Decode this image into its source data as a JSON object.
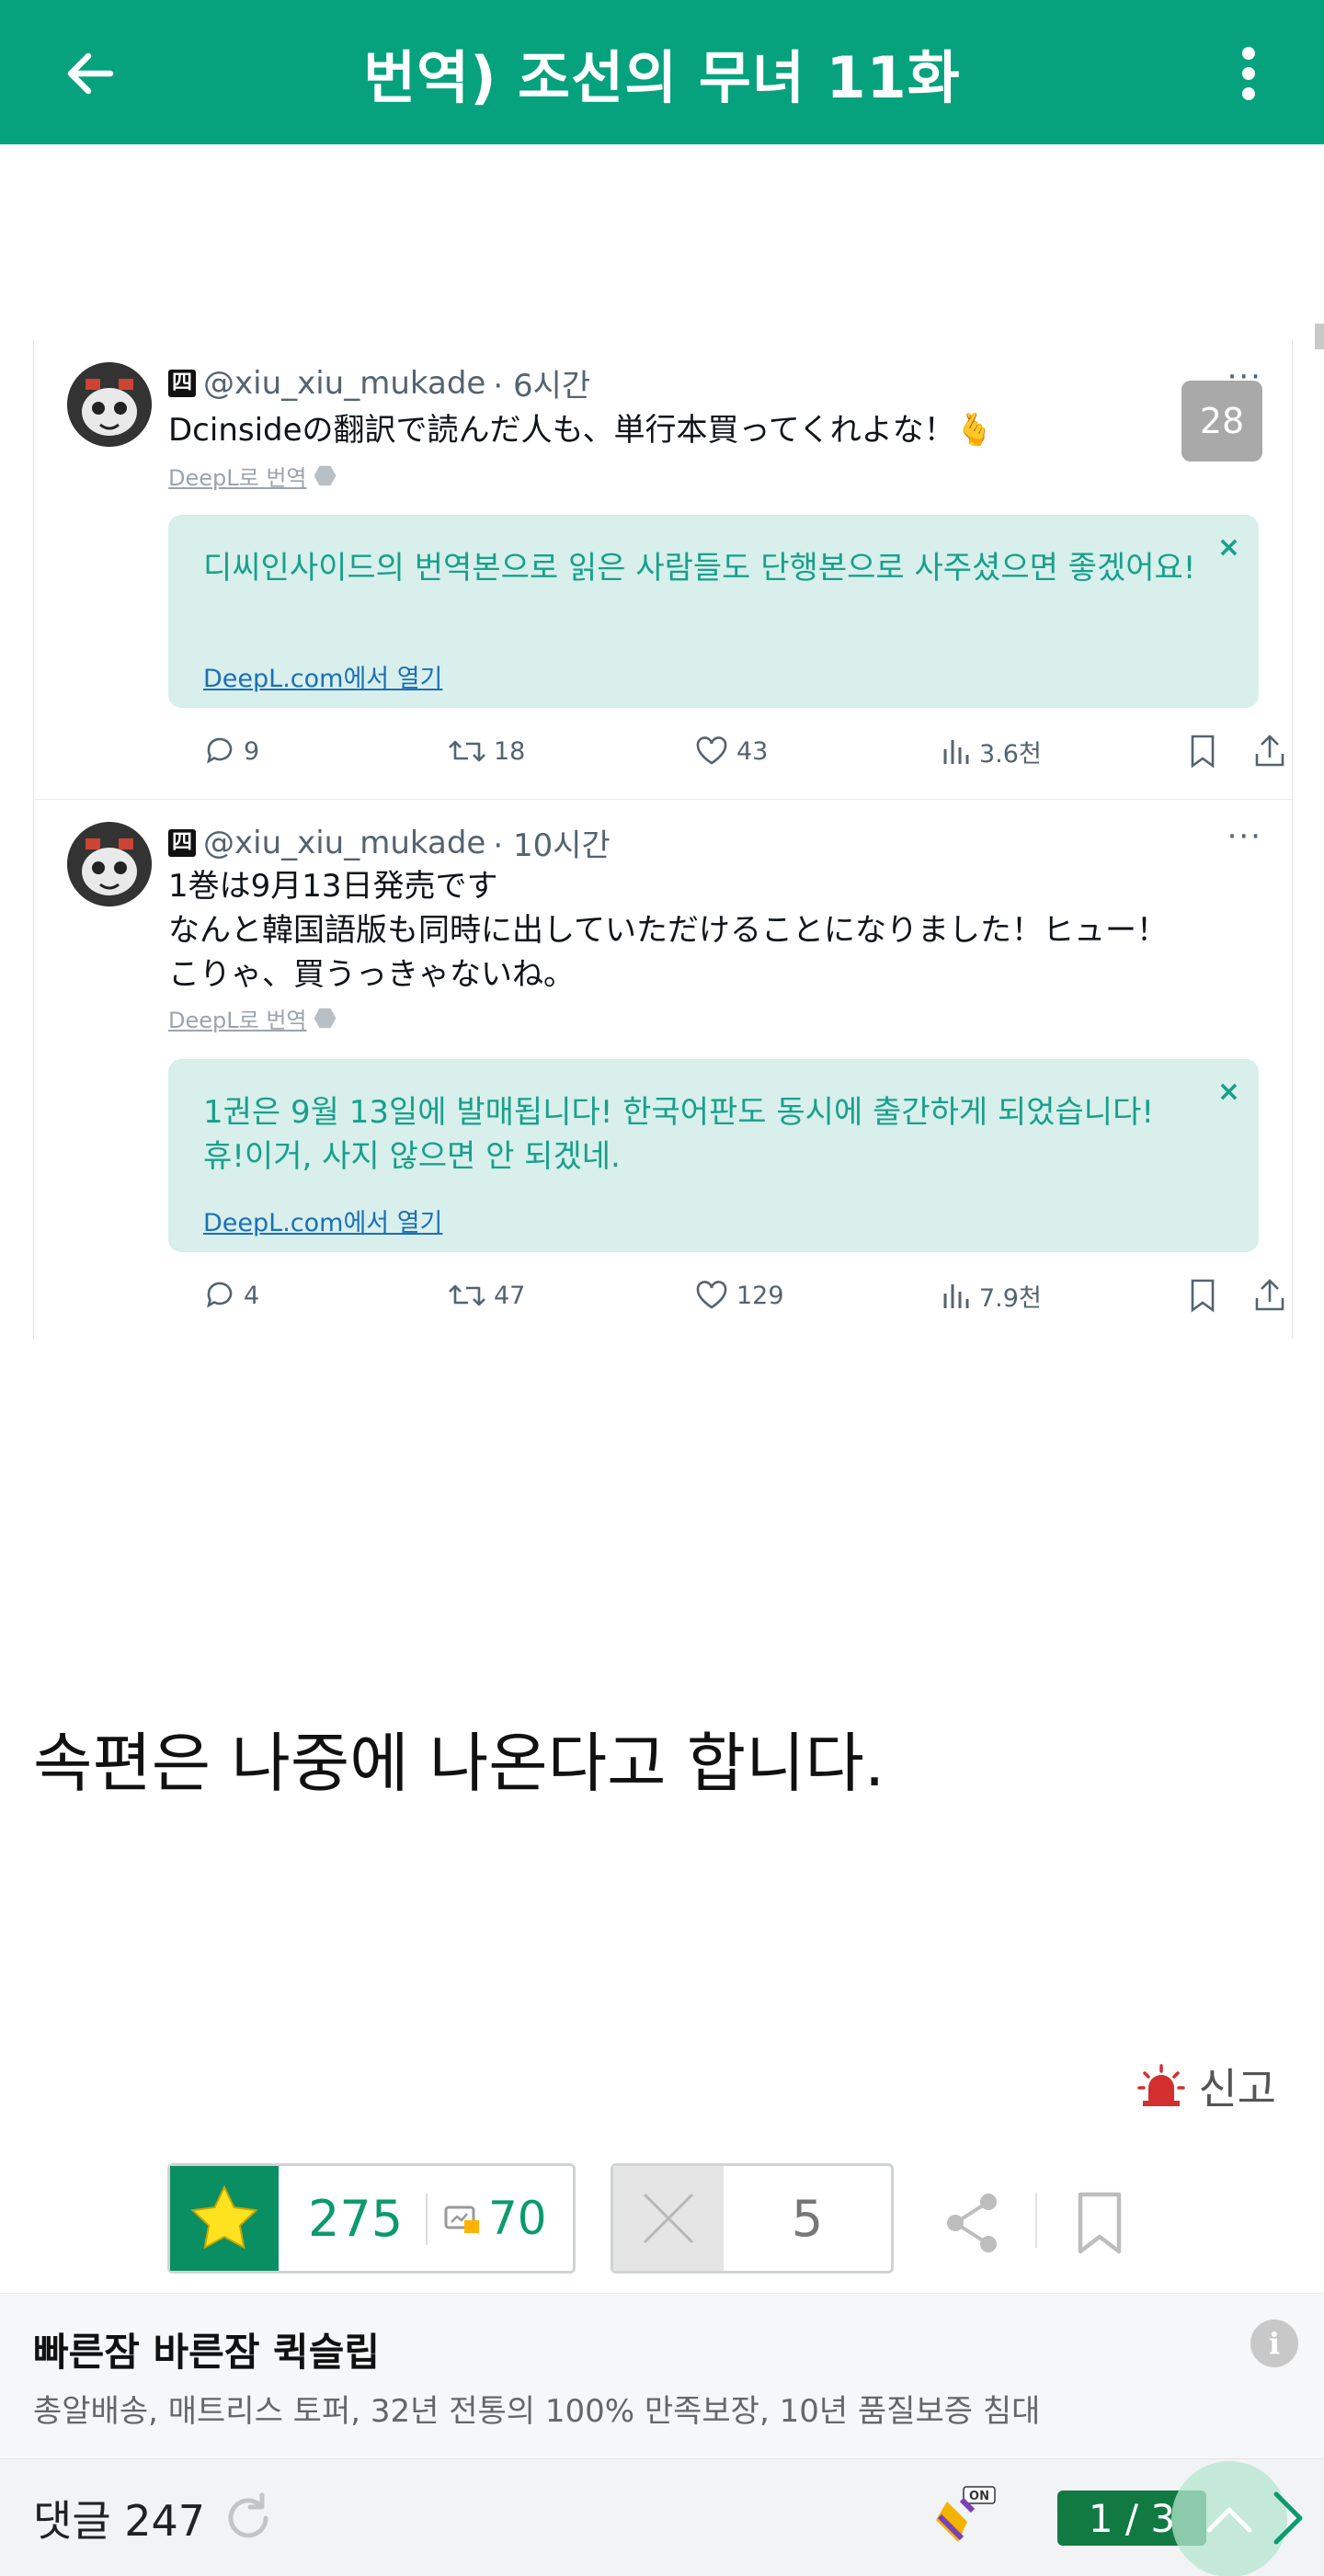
{
  "header": {
    "title": "번역) 조선의 무녀 11화",
    "back_icon": "arrow-left-icon",
    "more_icon": "vertical-dots-icon",
    "bg_color": "#05a27d"
  },
  "tweets": [
    {
      "badge": "四",
      "handle": "@xiu_xiu_mukade",
      "time": "· 6시간",
      "lines": [
        "Dcinsideの翻訳で読んだ人も、単行本買ってくれよな！🫰"
      ],
      "deepl_label": "DeepL로 번역",
      "translation": "디씨인사이드의 번역본으로 읽은 사람들도 단행본으로 사주셨으면 좋겠어요!",
      "open_link": "DeepL.com에서 열기",
      "replies": "9",
      "retweets": "18",
      "likes": "43",
      "views": "3.6천",
      "image_count": "28"
    },
    {
      "badge": "四",
      "handle": "@xiu_xiu_mukade",
      "time": "· 10시간",
      "lines": [
        "1巻は9月13日発売です",
        "なんと韓国語版も同時に出していただけることになりました！ヒュー！",
        "こりゃ、買うっきゃないね。"
      ],
      "deepl_label": "DeepL로 번역",
      "translation_lines": [
        "1권은 9월 13일에 발매됩니다! 한국어판도 동시에 출간하게 되었습니다!",
        "휴!이거, 사지 않으면 안 되겠네."
      ],
      "open_link": "DeepL.com에서 열기",
      "replies": "4",
      "retweets": "47",
      "likes": "129",
      "views": "7.9천"
    }
  ],
  "body_text": "속편은 나중에 나온다고 합니다.",
  "report_label": "신고",
  "votes": {
    "up_count": "275",
    "fixed_count": "70",
    "down_count": "5"
  },
  "ad": {
    "title": "빠른잠 바른잠 퀵슬립",
    "desc": "총알배송, 매트리스 토퍼, 32년 전통의 100% 만족보장, 10년 품질보증 침대",
    "info": "i"
  },
  "bottom_bar": {
    "comments_label": "댓글 247",
    "page": "1 / 3"
  },
  "colors": {
    "accent": "#05a27d",
    "vote_green": "#0a8f63",
    "translation_text": "#17a08c"
  }
}
